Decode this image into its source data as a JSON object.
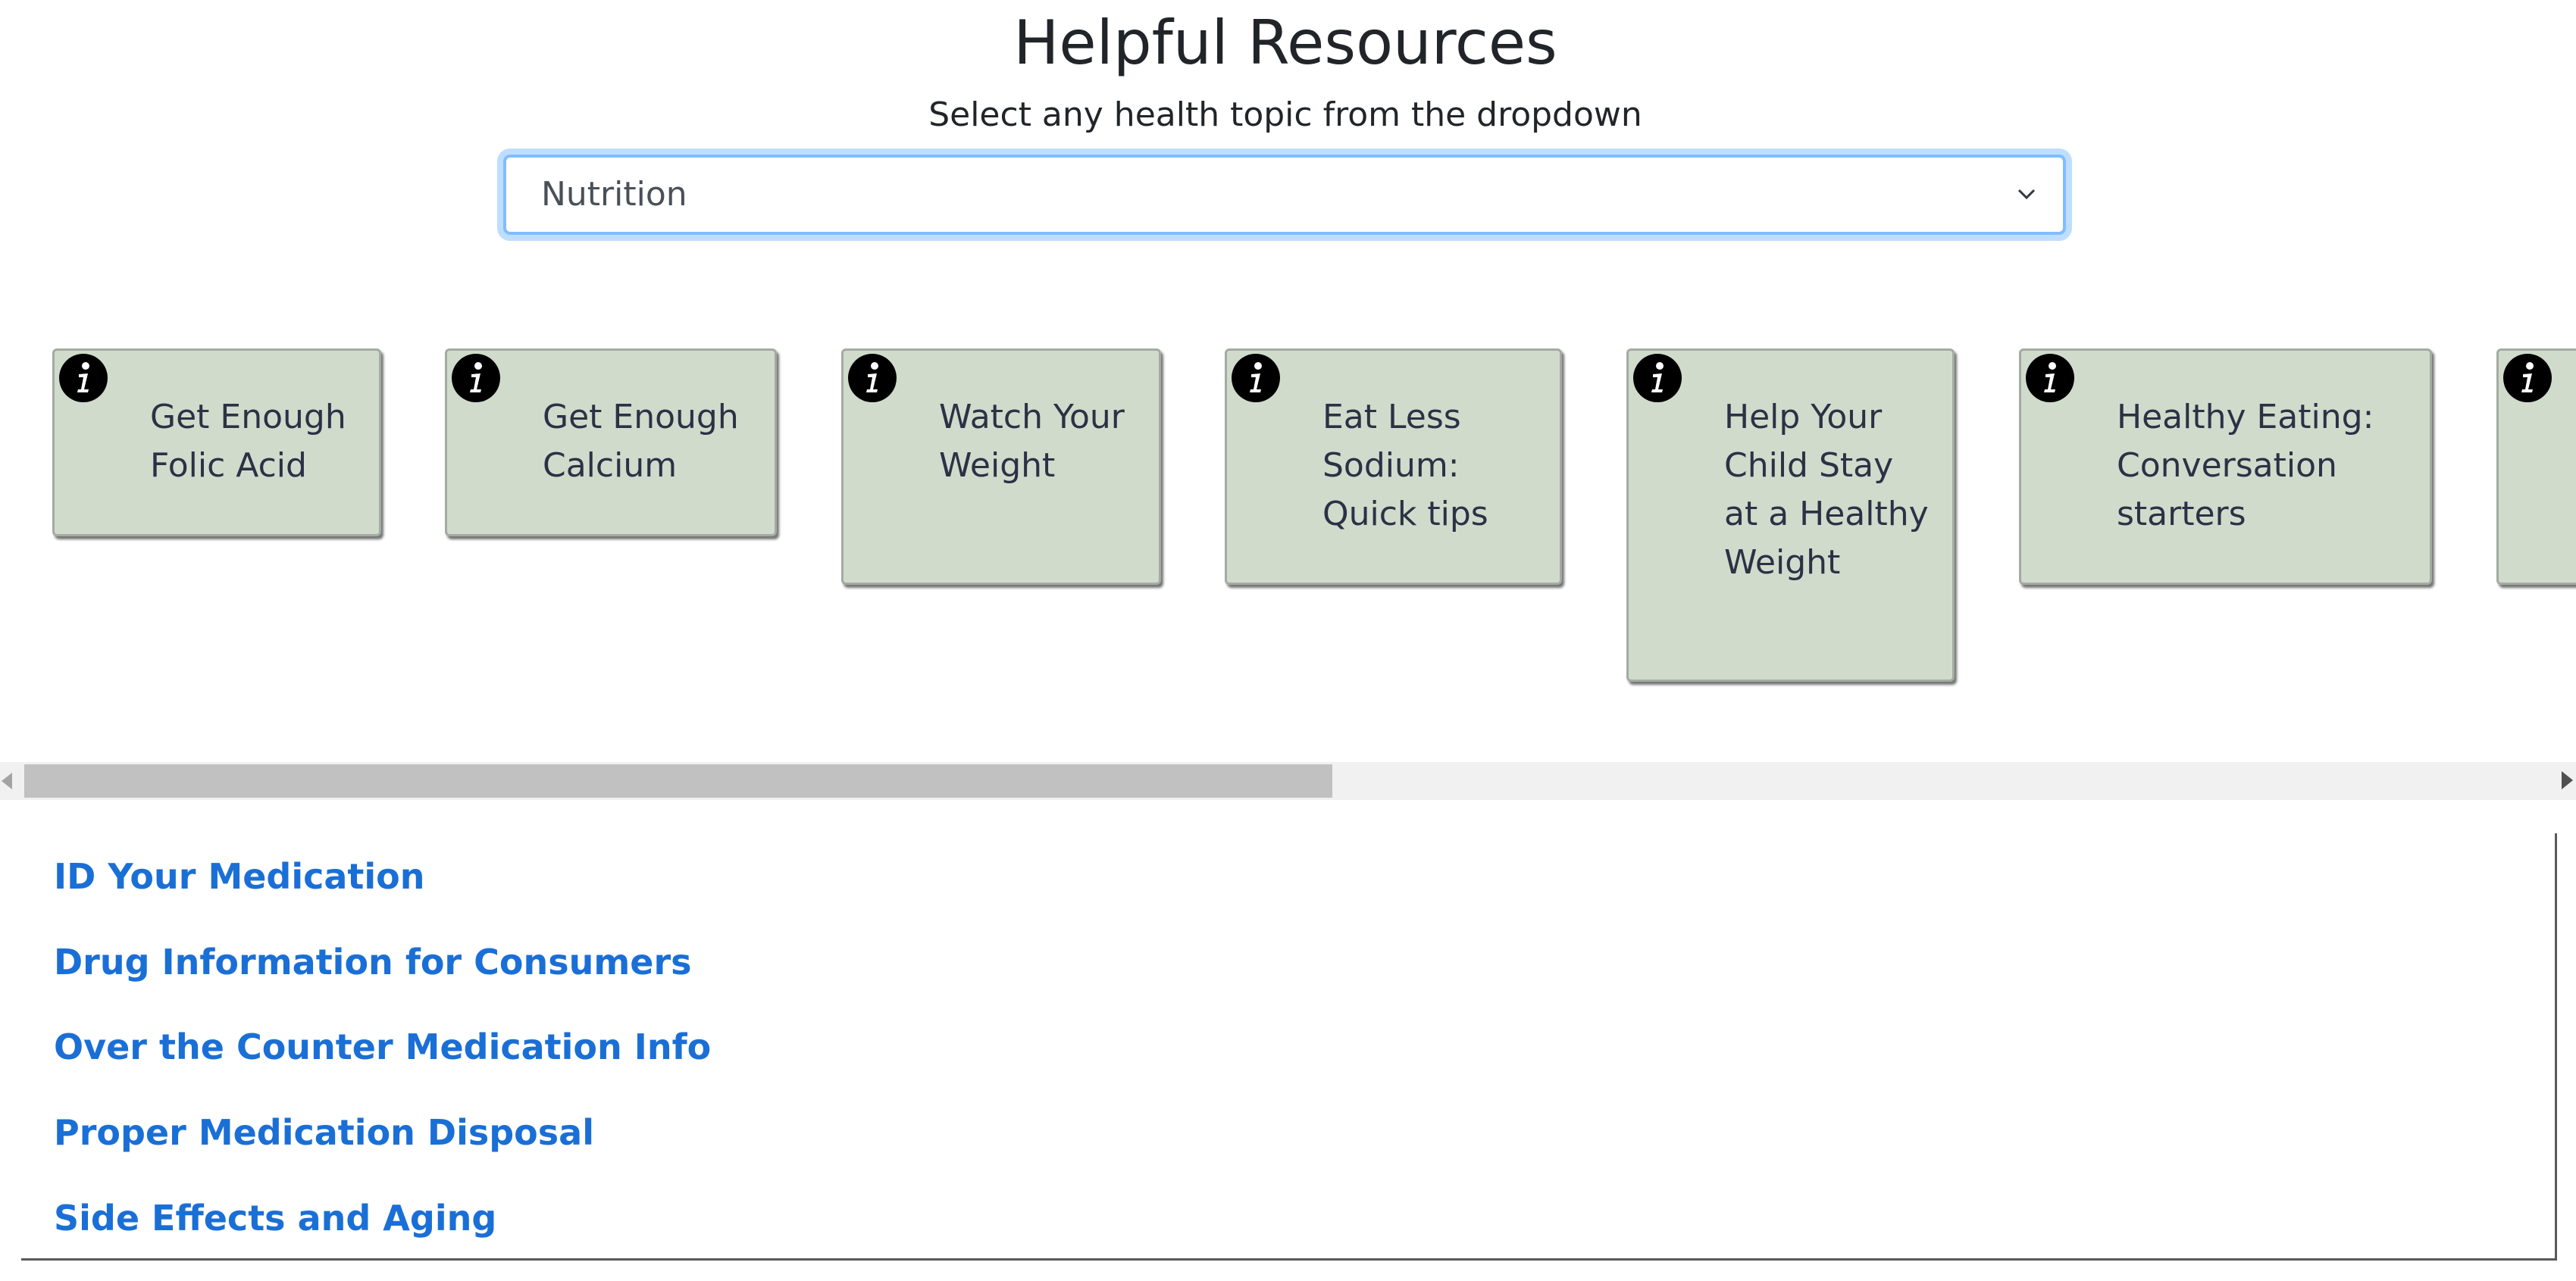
{
  "header": {
    "title": "Helpful Resources",
    "subtitle": "Select any health topic from the dropdown"
  },
  "topic_select": {
    "selected": "Nutrition"
  },
  "cards": [
    {
      "label": "Get Enough Folic Acid"
    },
    {
      "label": "Get Enough Calcium"
    },
    {
      "label": "Watch Your Weight"
    },
    {
      "label": "Eat Less Sodium: Quick tips"
    },
    {
      "label": "Help Your Child Stay at a Healthy Weight"
    },
    {
      "label": "Healthy Eating: Conversation starters"
    },
    {
      "label": ""
    }
  ],
  "icons": {
    "card_info": "info-icon",
    "select_arrow": "chevron-down-icon",
    "scroll_left": "scroll-left-arrow",
    "scroll_right": "scroll-right-arrow"
  },
  "links": [
    {
      "label": "ID Your Medication"
    },
    {
      "label": "Drug Information for Consumers"
    },
    {
      "label": "Over the Counter Medication Info"
    },
    {
      "label": "Proper Medication Disposal"
    },
    {
      "label": "Side Effects and Aging"
    }
  ],
  "colors": {
    "card_background": "#d0dbcc",
    "link": "#1a6fd6",
    "select_focus": "#80bdff"
  }
}
